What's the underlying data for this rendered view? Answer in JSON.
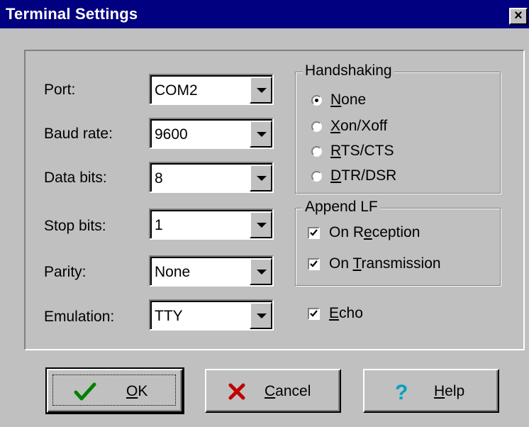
{
  "window": {
    "title": "Terminal Settings",
    "close_label": "×"
  },
  "fields": [
    {
      "label": "Port:",
      "value": "COM2"
    },
    {
      "label": "Baud rate:",
      "value": "9600"
    },
    {
      "label": "Data bits:",
      "value": "8"
    },
    {
      "label": "Stop bits:",
      "value": "1"
    },
    {
      "label": "Parity:",
      "value": "None"
    },
    {
      "label": "Emulation:",
      "value": "TTY"
    }
  ],
  "handshaking": {
    "legend": "Handshaking",
    "options": [
      {
        "label": "None",
        "accel": "N",
        "rest": "one",
        "selected": true
      },
      {
        "label": "Xon/Xoff",
        "accel": "X",
        "rest": "on/Xoff",
        "selected": false
      },
      {
        "label": "RTS/CTS",
        "accel": "R",
        "rest": "TS/CTS",
        "selected": false
      },
      {
        "label": "DTR/DSR",
        "accel": "D",
        "rest": "TR/DSR",
        "selected": false
      }
    ]
  },
  "append_lf": {
    "legend": "Append LF",
    "reception": {
      "label": "On Reception",
      "pre": "On R",
      "accel": "e",
      "rest": "ception",
      "checked": true
    },
    "transmission": {
      "label": "On Transmission",
      "pre": "On ",
      "accel": "T",
      "rest": "ransmission",
      "checked": true
    }
  },
  "echo": {
    "label": "Echo",
    "accel": "E",
    "rest": "cho",
    "checked": true
  },
  "buttons": {
    "ok": {
      "label": "OK",
      "accel": "O",
      "rest": "K",
      "icon": "checkmark-icon",
      "color": "#008000"
    },
    "cancel": {
      "label": "Cancel",
      "accel": "C",
      "rest": "ancel",
      "icon": "x-icon",
      "color": "#c00000"
    },
    "help": {
      "label": "Help",
      "accel": "H",
      "rest": "elp",
      "icon": "question-icon",
      "color": "#00a0c0"
    }
  }
}
